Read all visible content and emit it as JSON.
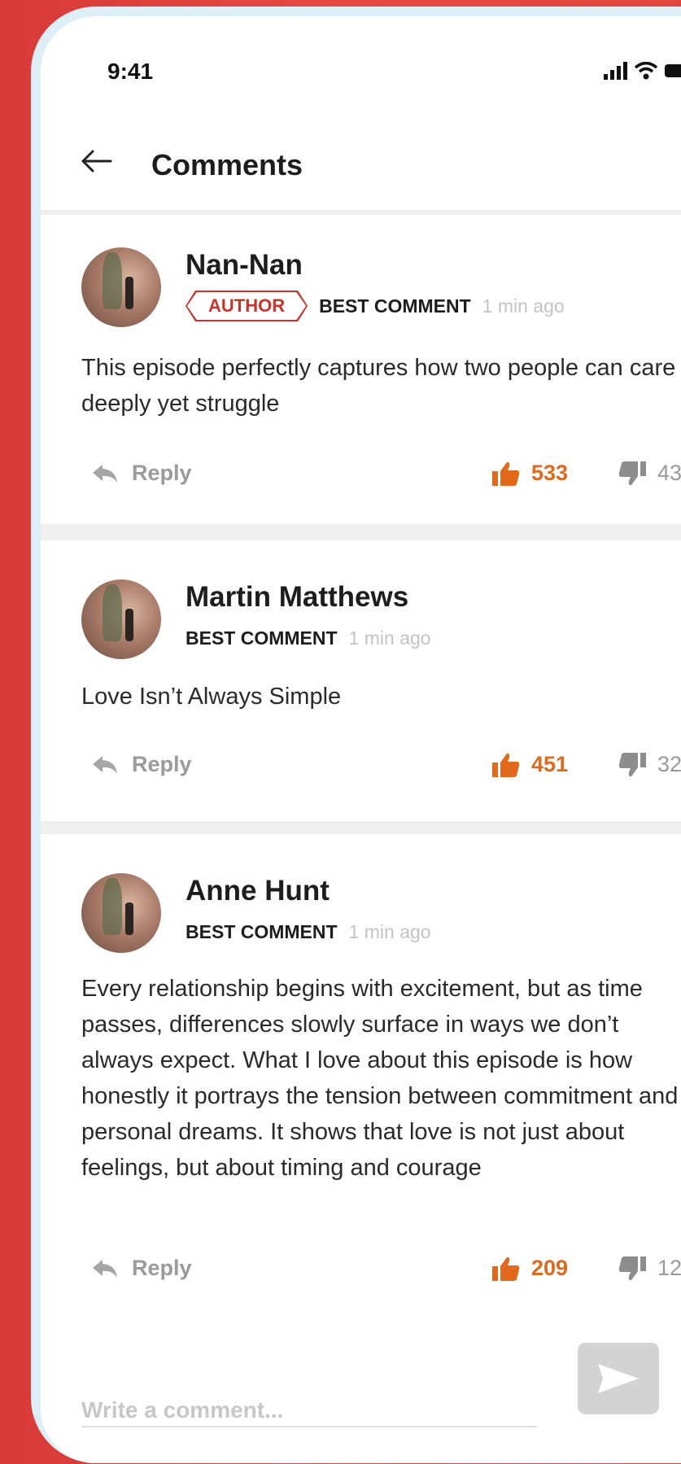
{
  "status_bar": {
    "time": "9:41"
  },
  "header": {
    "title": "Comments"
  },
  "comments": [
    {
      "name": "Nan-Nan",
      "badge": "AUTHOR",
      "tag": "BEST COMMENT",
      "ago": "1 min ago",
      "text": "This episode perfectly captures how two people can care deeply yet struggle",
      "reply_label": "Reply",
      "likes": "533",
      "dislikes": "43"
    },
    {
      "name": "Martin Matthews",
      "tag": "BEST COMMENT",
      "ago": "1 min ago",
      "text": "Love Isn’t Always Simple",
      "reply_label": "Reply",
      "likes": "451",
      "dislikes": "32"
    },
    {
      "name": "Anne Hunt",
      "tag": "BEST COMMENT",
      "ago": "1 min ago",
      "text": "Every relationship begins with excitement, but as time passes, differences slowly surface in ways we don’t always expect. What I love about this episode is how honestly it portrays the tension between commitment and personal dreams. It shows that love is not just about feelings, but about timing and courage",
      "reply_label": "Reply",
      "likes": "209",
      "dislikes": "12"
    }
  ],
  "composer": {
    "placeholder": "Write a comment..."
  },
  "icons": {
    "back": "back-arrow-icon",
    "signal": "signal-icon",
    "wifi": "wifi-icon",
    "battery": "battery-icon",
    "reply": "reply-icon",
    "like": "thumbs-up-icon",
    "dislike": "thumbs-down-icon",
    "send": "send-icon"
  },
  "colors": {
    "accent": "#e0691e",
    "author": "#c8342c",
    "background": "#de3f3b"
  }
}
